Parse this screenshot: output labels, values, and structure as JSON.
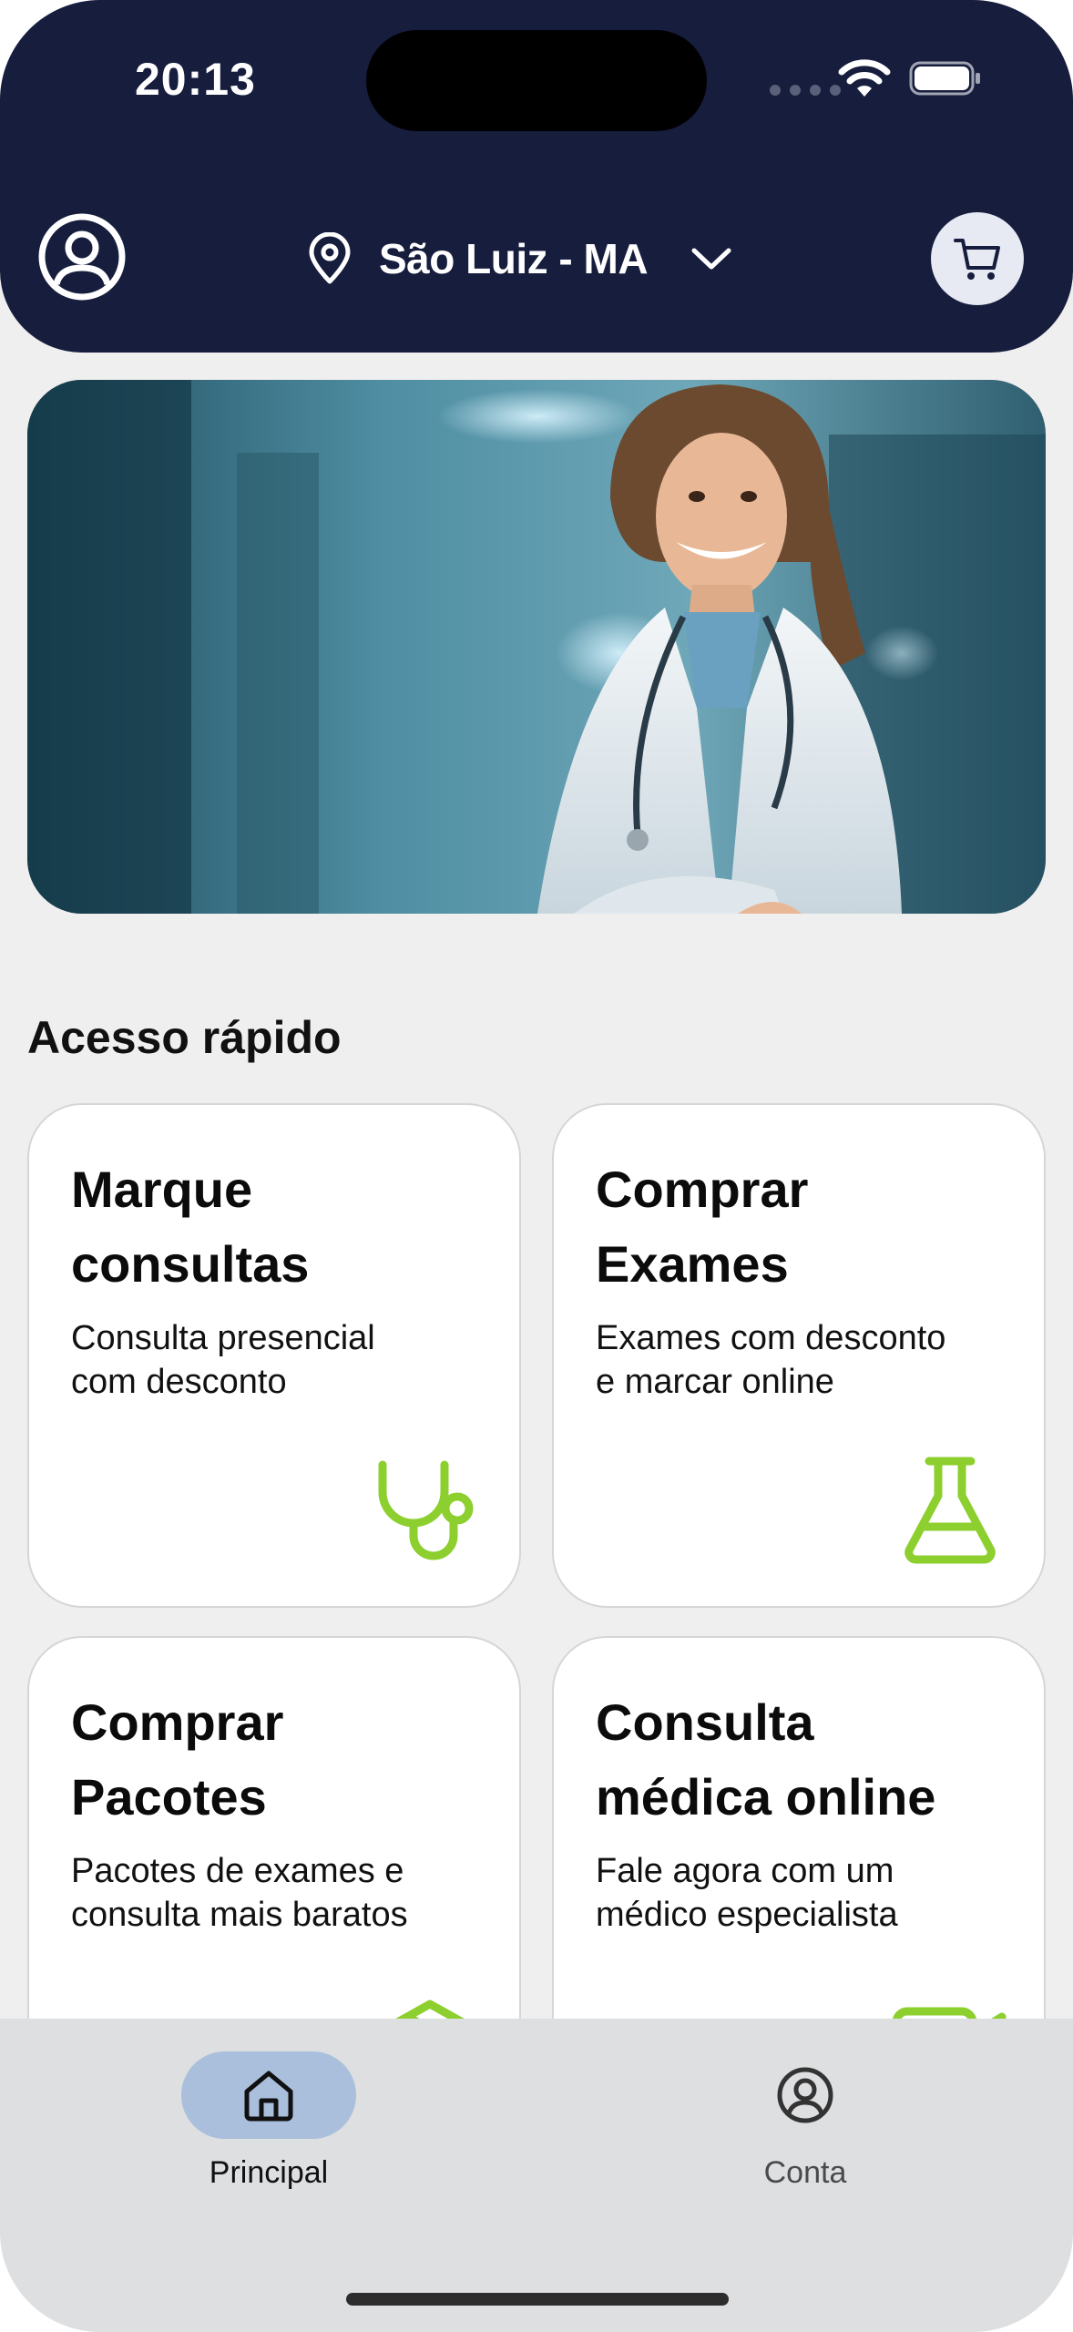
{
  "status_bar": {
    "time": "20:13",
    "icons": [
      "cellular-dots-icon",
      "wifi-icon",
      "battery-icon"
    ]
  },
  "header": {
    "profile_icon": "user-circle-icon",
    "location_icon": "map-pin-icon",
    "location": "São Luiz - MA",
    "dropdown_icon": "chevron-down-icon",
    "cart_icon": "shopping-cart-icon"
  },
  "hero": {
    "image": "doctor-hospital-photo"
  },
  "quick_access": {
    "title": "Acesso rápido",
    "cards": [
      {
        "title": "Marque\nconsultas",
        "description": "Consulta presencial\ncom desconto",
        "icon": "stethoscope-icon"
      },
      {
        "title": "Comprar\nExames",
        "description": "Exames com desconto\ne marcar online",
        "icon": "flask-icon"
      },
      {
        "title": "Comprar\nPacotes",
        "description": "Pacotes de exames e\nconsulta mais baratos",
        "icon": "package-icon"
      },
      {
        "title": "Consulta\nmédica online",
        "description": "Fale agora com um\nmédico especialista",
        "icon": "video-call-icon"
      }
    ]
  },
  "tabbar": {
    "tabs": [
      {
        "label": "Principal",
        "icon": "home-icon",
        "active": true
      },
      {
        "label": "Conta",
        "icon": "user-circle-icon",
        "active": false
      }
    ]
  },
  "colors": {
    "header_bg": "#161d3d",
    "accent_green": "#8ccf2e",
    "active_tab_pill": "#a9bfdb",
    "page_bg": "#efefef"
  }
}
